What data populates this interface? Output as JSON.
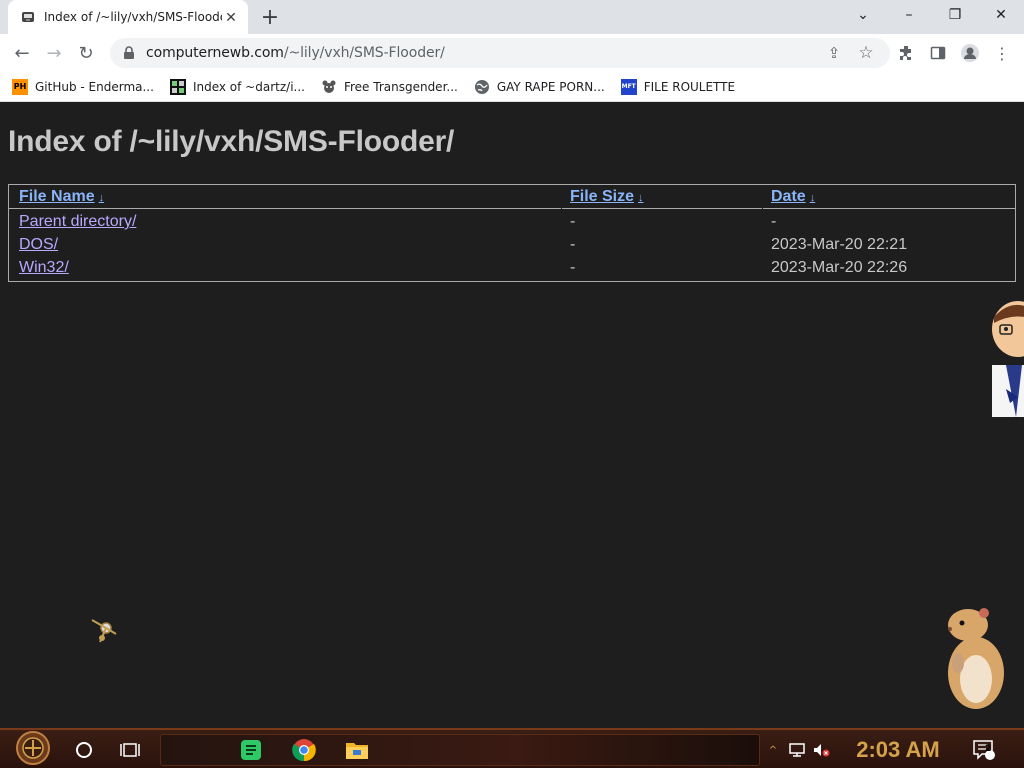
{
  "browser": {
    "tab": {
      "title": "Index of /~lily/vxh/SMS-Flooder/",
      "close_icon": "close-icon"
    },
    "new_tab_icon": "plus-icon",
    "window_controls": {
      "tabsearch": "⌄",
      "minimize": "–",
      "restore": "❐",
      "close": "✕"
    },
    "url": {
      "host": "computernewb.com",
      "path": "/~lily/vxh/SMS-Flooder/"
    },
    "bookmarks": [
      {
        "label": "GitHub - Enderma...",
        "icon": "PH",
        "color": "#ff9000"
      },
      {
        "label": "Index of ~dartz/i...",
        "icon": "grid-icon",
        "color": "#000000"
      },
      {
        "label": "Free Transgender...",
        "icon": "rat-icon",
        "color": "#444444"
      },
      {
        "label": "GAY RAPE PORN...",
        "icon": "globe-icon",
        "color": "#5f6368"
      },
      {
        "label": "FILE ROULETTE",
        "icon": "MFT",
        "color": "#2244cc"
      }
    ]
  },
  "page": {
    "title": "Index of /~lily/vxh/SMS-Flooder/",
    "columns": {
      "name": "File Name",
      "size": "File Size",
      "date": "Date",
      "sort_glyph": "↓"
    },
    "rows": [
      {
        "name": "Parent directory/",
        "size": "-",
        "date": "-"
      },
      {
        "name": "DOS/",
        "size": "-",
        "date": "2023-Mar-20 22:21"
      },
      {
        "name": "Win32/",
        "size": "-",
        "date": "2023-Mar-20 22:26"
      }
    ]
  },
  "taskbar": {
    "clock": "2:03 AM",
    "notifications_count": "2",
    "accent": "#d4a24a"
  }
}
